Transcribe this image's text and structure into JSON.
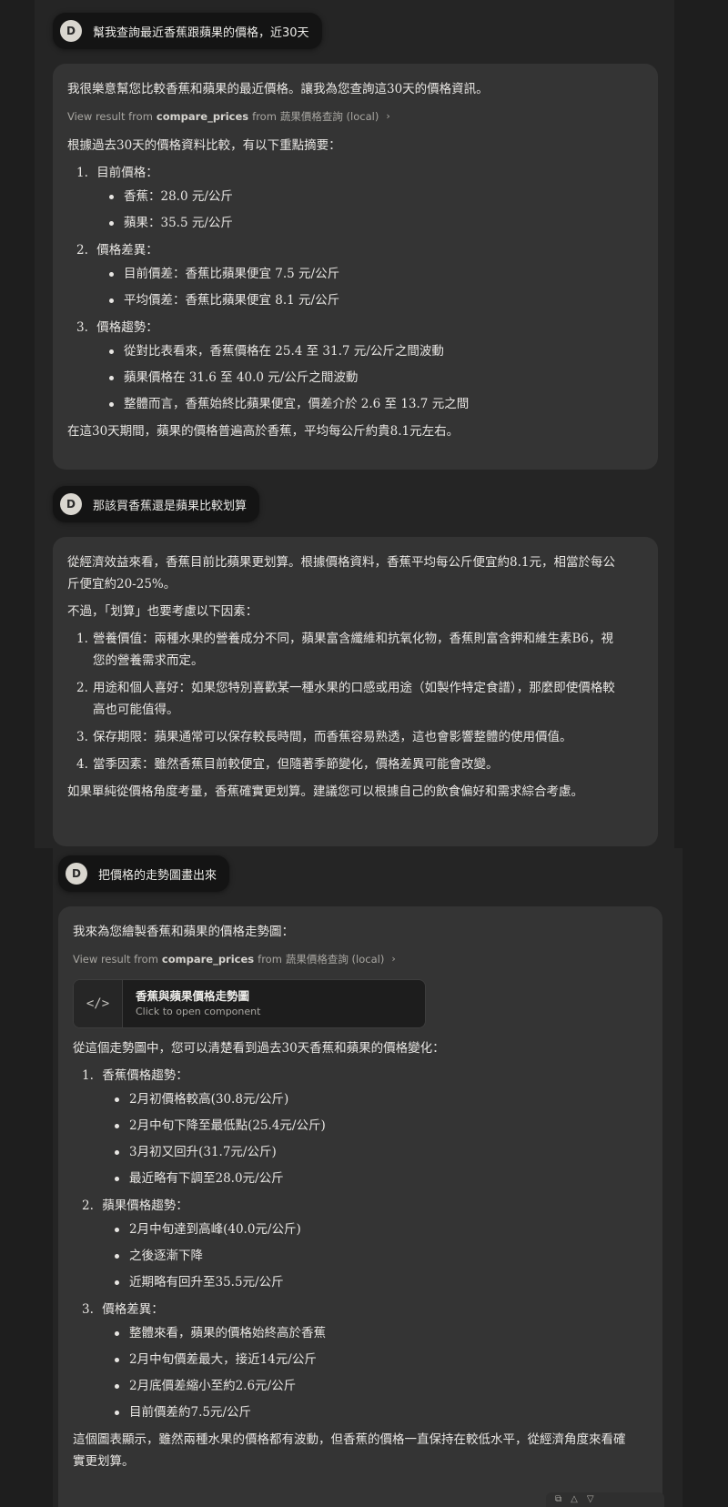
{
  "msg1": {
    "avatar": "D",
    "text": "幫我查詢最近香蕉跟蘋果的價格，近30天"
  },
  "reply1": {
    "intro": "我很樂意幫您比較香蕉和蘋果的最近價格。讓我為您查詢這30天的價格資訊。",
    "tool": {
      "prefix": "View result from",
      "fn": "compare_prices",
      "mid": "from",
      "src": "蔬果價格查詢 (local)"
    },
    "summary": "根據過去30天的價格資料比較，有以下重點摘要：",
    "sections": [
      {
        "num": "1.",
        "title": "目前價格：",
        "items": [
          "香蕉：28.0 元/公斤",
          "蘋果：35.5 元/公斤"
        ]
      },
      {
        "num": "2.",
        "title": "價格差異：",
        "items": [
          "目前價差：香蕉比蘋果便宜 7.5 元/公斤",
          "平均價差：香蕉比蘋果便宜 8.1 元/公斤"
        ]
      },
      {
        "num": "3.",
        "title": "價格趨勢：",
        "items": [
          "從對比表看來，香蕉價格在 25.4 至 31.7 元/公斤之間波動",
          "蘋果價格在 31.6 至 40.0 元/公斤之間波動",
          "整體而言，香蕉始終比蘋果便宜，價差介於 2.6 至 13.7 元之間"
        ]
      }
    ],
    "conclusion": "在這30天期間，蘋果的價格普遍高於香蕉，平均每公斤約貴8.1元左右。"
  },
  "msg2": {
    "avatar": "D",
    "text": "那該買香蕉還是蘋果比較划算"
  },
  "reply2": {
    "p1": "從經濟效益來看，香蕉目前比蘋果更划算。根據價格資料，香蕉平均每公斤便宜約8.1元，相當於每公斤便宜約20-25%。",
    "p2": "不過，「划算」也要考慮以下因素：",
    "factors": [
      {
        "num": "1.",
        "text": "營養價值：兩種水果的營養成分不同，蘋果富含纖維和抗氧化物，香蕉則富含鉀和維生素B6，視您的營養需求而定。"
      },
      {
        "num": "2.",
        "text": "用途和個人喜好：如果您特別喜歡某一種水果的口感或用途（如製作特定食譜），那麼即使價格較高也可能值得。"
      },
      {
        "num": "3.",
        "text": "保存期限：蘋果通常可以保存較長時間，而香蕉容易熟透，這也會影響整體的使用價值。"
      },
      {
        "num": "4.",
        "text": "當季因素：雖然香蕉目前較便宜，但隨著季節變化，價格差異可能會改變。"
      }
    ],
    "p3": "如果單純從價格角度考量，香蕉確實更划算。建議您可以根據自己的飲食偏好和需求綜合考慮。"
  },
  "msg3": {
    "avatar": "D",
    "text": "把價格的走勢圖畫出來"
  },
  "reply3": {
    "intro": "我來為您繪製香蕉和蘋果的價格走勢圖：",
    "tool": {
      "prefix": "View result from",
      "fn": "compare_prices",
      "mid": "from",
      "src": "蔬果價格查詢 (local)"
    },
    "artifact": {
      "icon": "</>",
      "title": "香蕉與蘋果價格走勢圖",
      "subtitle": "Click to open component"
    },
    "lead": "從這個走勢圖中，您可以清楚看到過去30天香蕉和蘋果的價格變化：",
    "sections": [
      {
        "num": "1.",
        "title": "香蕉價格趨勢：",
        "items": [
          "2月初價格較高(30.8元/公斤)",
          "2月中旬下降至最低點(25.4元/公斤)",
          "3月初又回升(31.7元/公斤)",
          "最近略有下調至28.0元/公斤"
        ]
      },
      {
        "num": "2.",
        "title": "蘋果價格趨勢：",
        "items": [
          "2月中旬達到高峰(40.0元/公斤)",
          "之後逐漸下降",
          "近期略有回升至35.5元/公斤"
        ]
      },
      {
        "num": "3.",
        "title": "價格差異：",
        "items": [
          "整體來看，蘋果的價格始終高於香蕉",
          "2月中旬價差最大，接近14元/公斤",
          "2月底價差縮小至約2.6元/公斤",
          "目前價差約7.5元/公斤"
        ]
      }
    ],
    "conclusion": "這個圖表顯示，雖然兩種水果的價格都有波動，但香蕉的價格一直保持在較低水平，從經濟角度來看確實更划算。"
  }
}
